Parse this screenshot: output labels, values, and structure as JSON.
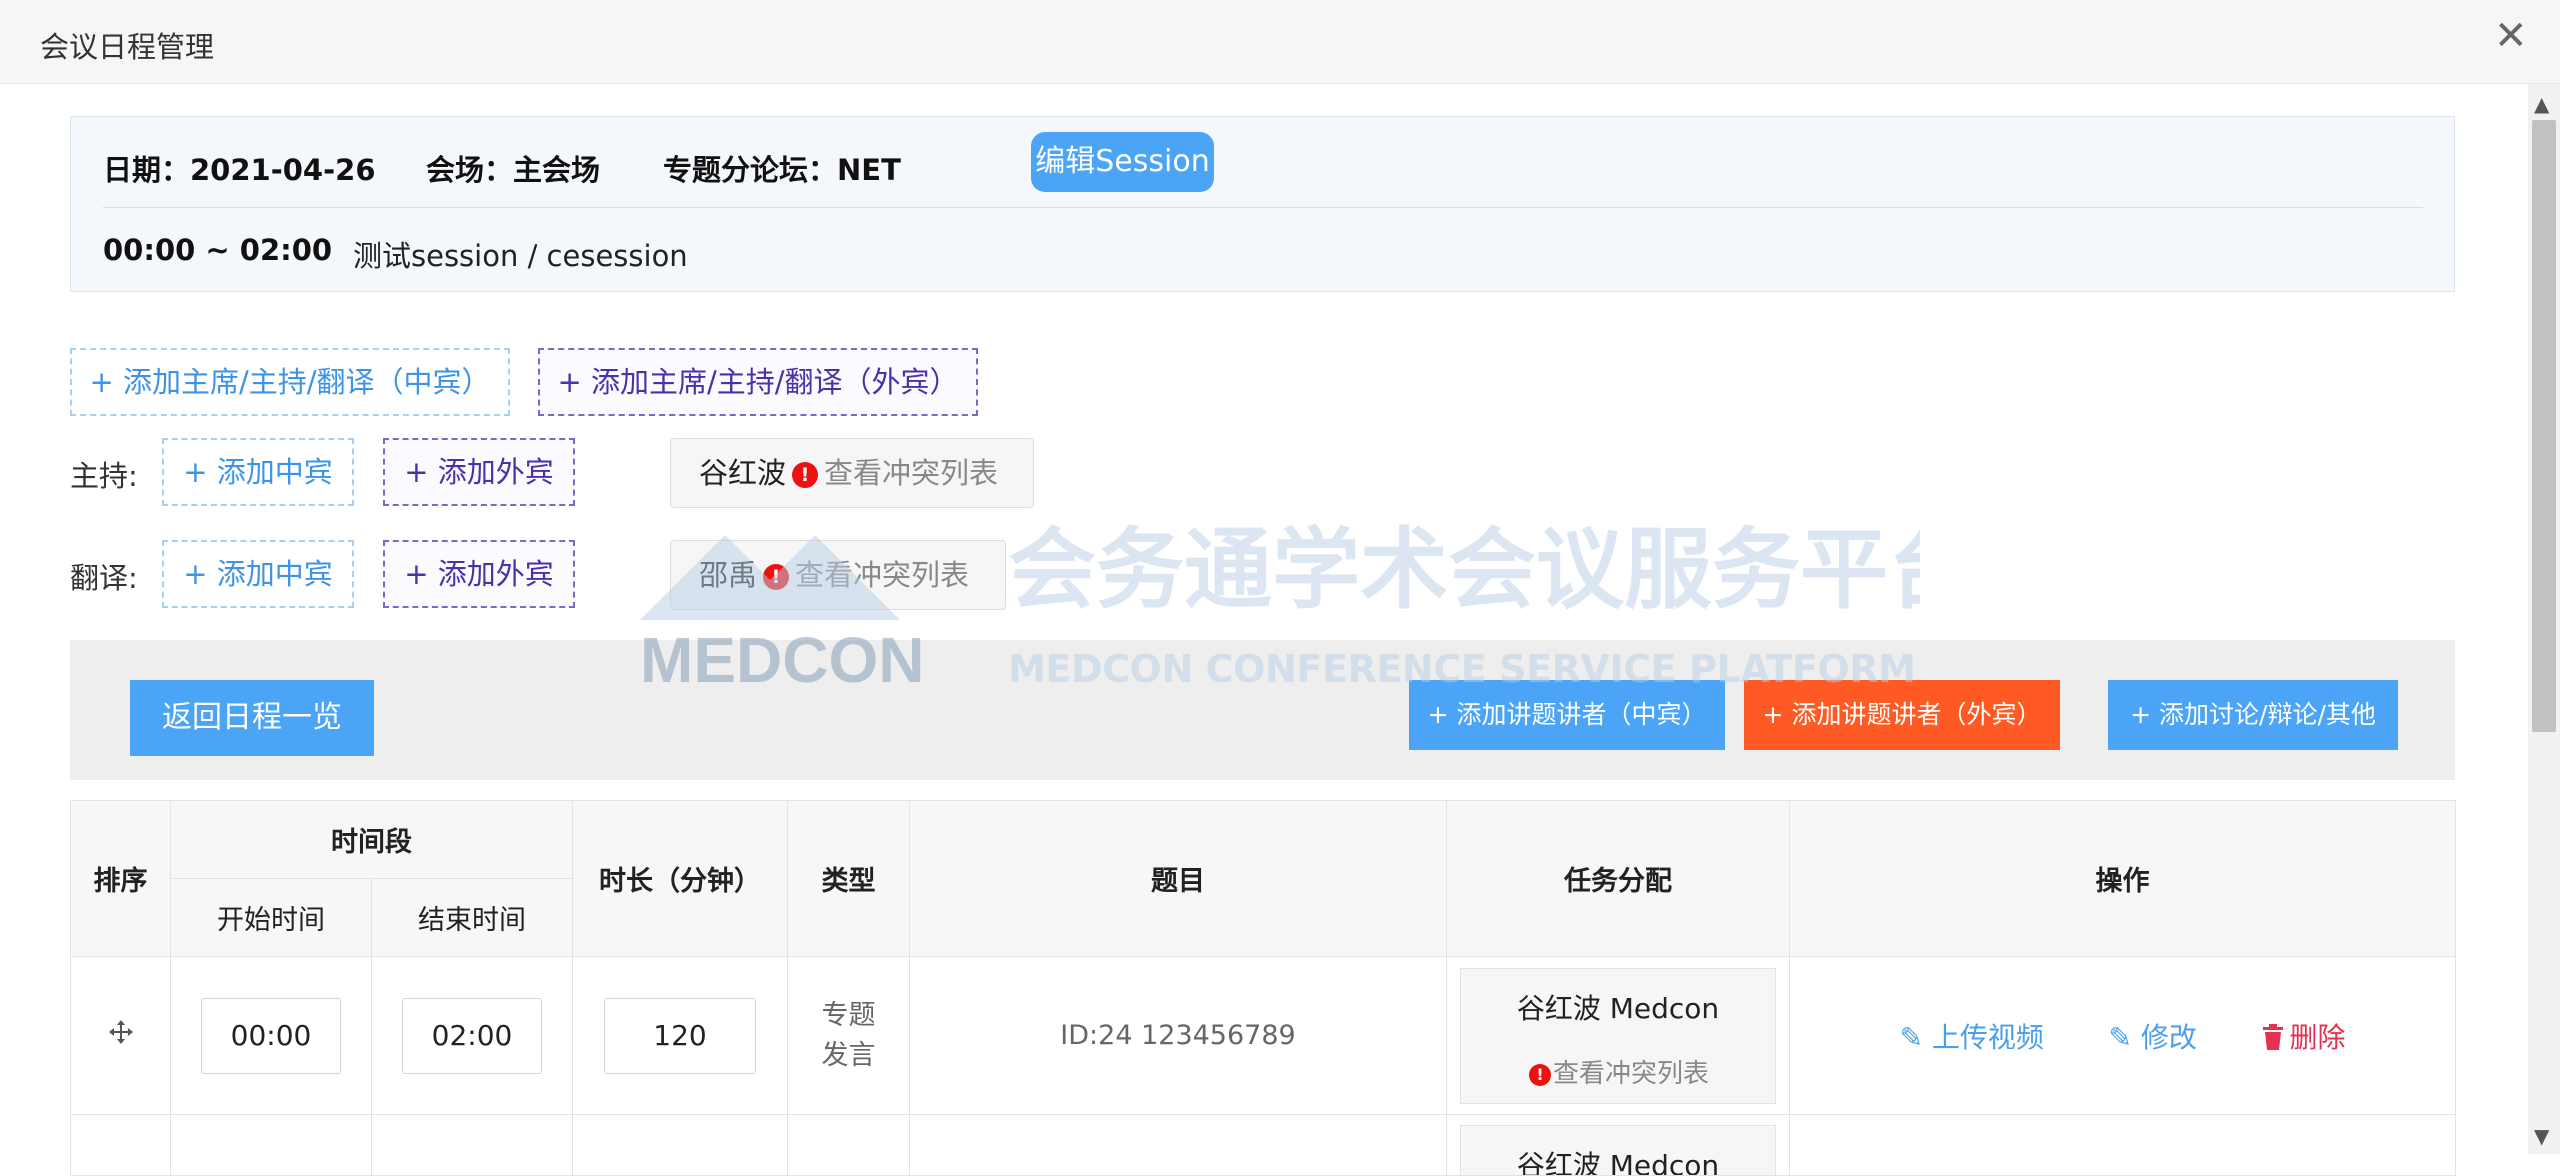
{
  "window": {
    "title": "会议日程管理",
    "close_glyph": "✕"
  },
  "info": {
    "date": "日期：2021-04-26",
    "venue": "会场：主会场",
    "forum": "专题分论坛：NET",
    "edit_button": "编辑Session",
    "time_range": "00:00 ~ 02:00",
    "session_name": "测试session / cesession"
  },
  "add_buttons": {
    "chair_domestic": "+ 添加主席/主持/翻译（中宾）",
    "chair_foreign": "+ 添加主席/主持/翻译（外宾）"
  },
  "roles": [
    {
      "label": "主持:",
      "add_domestic": "+ 添加中宾",
      "add_foreign": "+ 添加外宾",
      "person": "谷红波",
      "conflict": "查看冲突列表"
    },
    {
      "label": "翻译:",
      "add_domestic": "+ 添加中宾",
      "add_foreign": "+ 添加外宾",
      "person": "邵禹",
      "conflict": "查看冲突列表"
    }
  ],
  "watermark": {
    "cn": "会务通学术会议服务平台",
    "logo": "MEDCON",
    "en": "MEDCON CONFERENCE SERVICE PLATFORM"
  },
  "toolbar": {
    "back": "返回日程一览",
    "add_speaker_domestic": "+ 添加讲题讲者（中宾）",
    "add_speaker_foreign": "+ 添加讲题讲者（外宾）",
    "add_discussion": "+ 添加讨论/辩论/其他"
  },
  "colors": {
    "primary": "#4ba4f5",
    "accent_orange": "#ff5a23",
    "danger": "#e5304f"
  },
  "table": {
    "headers": {
      "order": "排序",
      "period": "时间段",
      "start": "开始时间",
      "end": "结束时间",
      "duration": "时长（分钟）",
      "type": "类型",
      "topic": "题目",
      "assign": "任务分配",
      "ops": "操作"
    },
    "rows": [
      {
        "start": "00:00",
        "end": "02:00",
        "duration": "120",
        "type": "专题发言",
        "topic": "ID:24 123456789",
        "assignee": "谷红波 Medcon",
        "conflict": "查看冲突列表",
        "upload": "上传视频",
        "edit": "修改",
        "delete": "删除"
      },
      {
        "assignee": "谷红波 Medcon"
      }
    ]
  }
}
